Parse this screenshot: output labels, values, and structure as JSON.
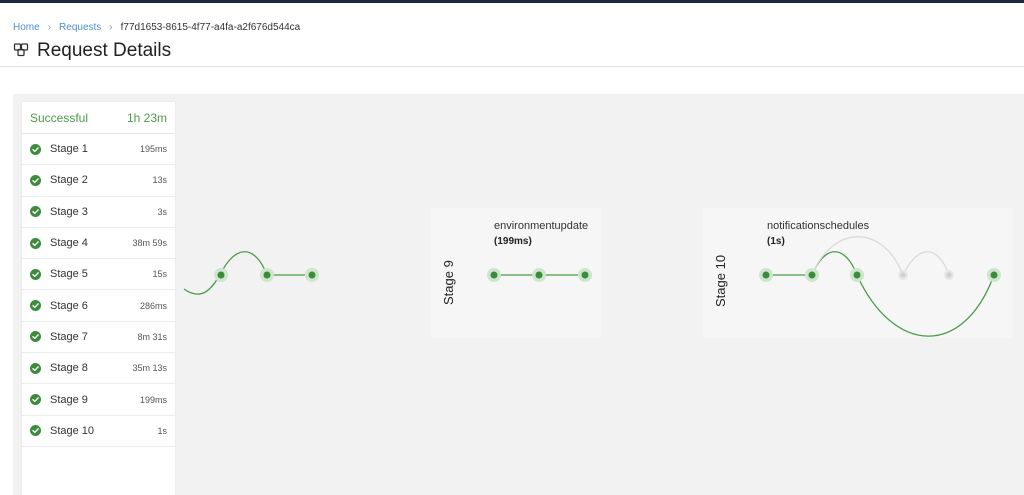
{
  "breadcrumb": {
    "home": "Home",
    "requests": "Requests",
    "current": "f77d1653-8615-4f77-a4fa-a2f676d544ca"
  },
  "page": {
    "title": "Request Details",
    "icon": "request-icon"
  },
  "summary": {
    "status": "Successful",
    "total": "1h 23m"
  },
  "stages": [
    {
      "label": "Stage 1",
      "duration": "195ms"
    },
    {
      "label": "Stage 2",
      "duration": "13s"
    },
    {
      "label": "Stage 3",
      "duration": "3s"
    },
    {
      "label": "Stage 4",
      "duration": "38m 59s"
    },
    {
      "label": "Stage 5",
      "duration": "15s"
    },
    {
      "label": "Stage 6",
      "duration": "286ms"
    },
    {
      "label": "Stage 7",
      "duration": "8m 31s"
    },
    {
      "label": "Stage 8",
      "duration": "35m 13s"
    },
    {
      "label": "Stage 9",
      "duration": "199ms"
    },
    {
      "label": "Stage 10",
      "duration": "1s"
    }
  ],
  "flow": {
    "stage9": {
      "label": "Stage 9",
      "task": "environmentupdate",
      "duration": "(199ms)"
    },
    "stage10": {
      "label": "Stage 10",
      "task": "notificationschedules",
      "duration": "(1s)"
    }
  },
  "colors": {
    "success": "#4a9b4a",
    "node": "#3c8c3c",
    "node_halo": "#cde6cd",
    "inactive": "#d8d8d8",
    "link": "#4f8fc9"
  }
}
